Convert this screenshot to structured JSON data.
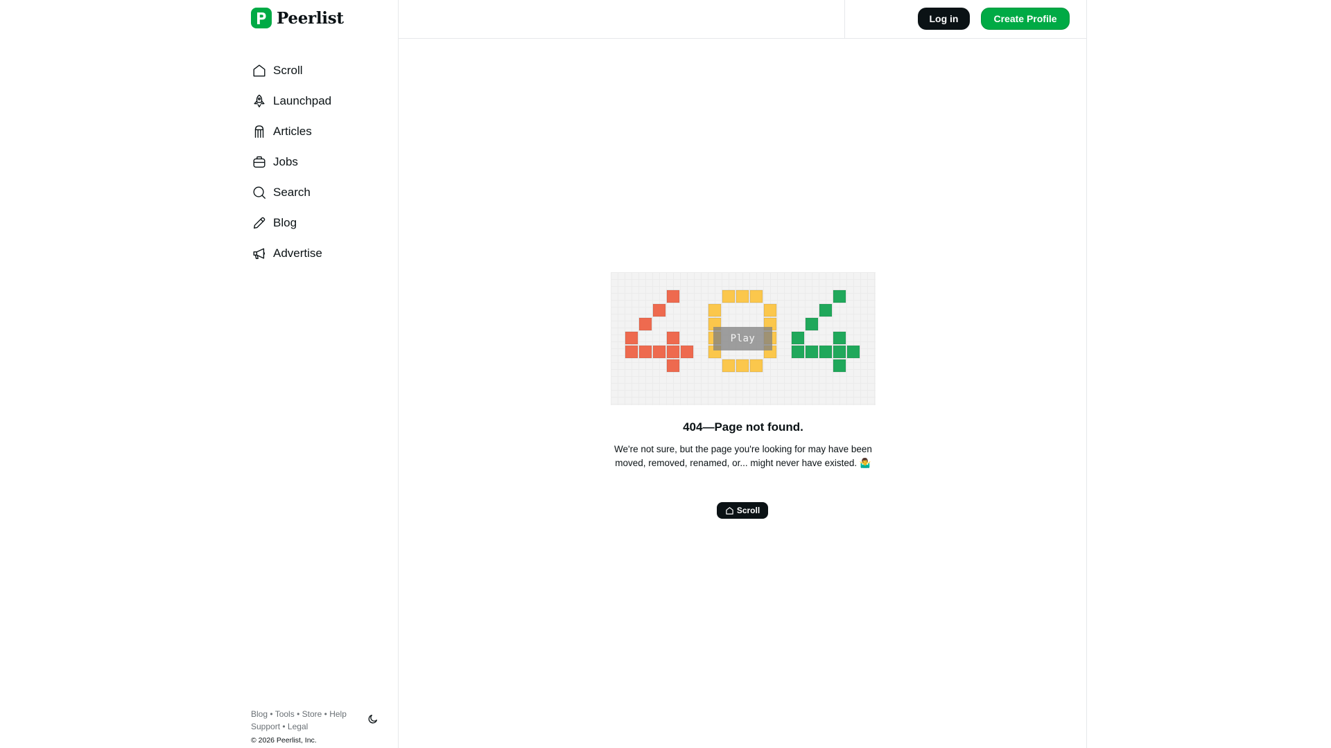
{
  "brand": {
    "name": "Peerlist",
    "mark_letter": "P",
    "color": "#00aa45"
  },
  "sidebar": {
    "items": [
      {
        "label": "Scroll",
        "icon": "home-icon"
      },
      {
        "label": "Launchpad",
        "icon": "rocket-icon"
      },
      {
        "label": "Articles",
        "icon": "articles-icon"
      },
      {
        "label": "Jobs",
        "icon": "briefcase-icon"
      },
      {
        "label": "Search",
        "icon": "search-icon"
      },
      {
        "label": "Blog",
        "icon": "pencil-icon"
      },
      {
        "label": "Advertise",
        "icon": "megaphone-icon"
      }
    ],
    "footer": {
      "links_row1": [
        "Blog",
        "Tools",
        "Store",
        "Help"
      ],
      "links_row2": [
        "Support",
        "Legal"
      ],
      "separator": "•",
      "copyright": "© 2026 Peerlist, Inc."
    }
  },
  "header": {
    "login_label": "Log in",
    "create_profile_label": "Create Profile"
  },
  "not_found": {
    "play_label": "Play",
    "title": "404—Page not found.",
    "description": "We're not sure, but the page you're looking for may have been moved, removed, renamed, or... might never have existed. 🤷‍♂️",
    "button_label": "Scroll",
    "digit_colors": {
      "first": "#ee6a4f",
      "middle": "#fbc74c",
      "last": "#20a85b"
    }
  }
}
